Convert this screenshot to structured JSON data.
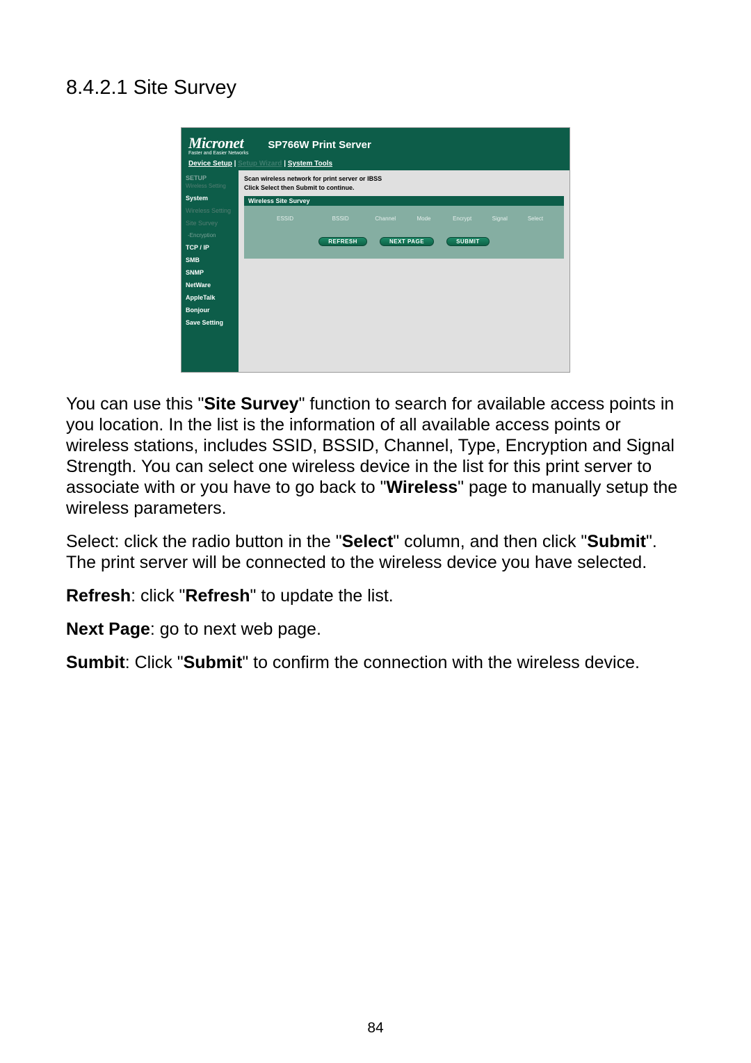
{
  "doc": {
    "heading": "8.4.2.1   Site Survey",
    "para1_pre": "You can use this \"",
    "para1_b1": "Site Survey",
    "para1_mid": "\" function to search for available access points in you location. In the list is the information of all available access points or wireless stations, includes SSID, BSSID, Channel, Type, Encryption and Signal Strength. You can select one wireless device in the list for this print server to associate with or you have to go back to \"",
    "para1_b2": "Wireless",
    "para1_end": "\" page to manually setup the wireless parameters.",
    "para2_pre": "Select: click the radio button in the \"",
    "para2_b1": "Select",
    "para2_mid": "\" column, and then click \"",
    "para2_b2": "Submit",
    "para2_end": "\". The print server will be connected to the wireless device you have selected.",
    "para3_b1": "Refresh",
    "para3_mid": ": click \"",
    "para3_b2": "Refresh",
    "para3_end": "\" to update the list.",
    "para4_b1": "Next Page",
    "para4_end": ": go to next web page.",
    "para5_b1": "Sumbit",
    "para5_mid": ": Click \"",
    "para5_b2": "Submit",
    "para5_end": "\" to confirm the connection with the wireless device.",
    "page_number": "84"
  },
  "screenshot": {
    "brand": "Micronet",
    "brand_sub": "Faster and Easier Networks",
    "title": "SP766W Print Server",
    "topnav": {
      "device_setup": "Device Setup",
      "setup_wizard": "Setup Wizard",
      "system_tools": "System Tools"
    },
    "sidebar": {
      "head": "SETUP",
      "sub": "Wireless Setting",
      "items": {
        "system": "System",
        "wireless_setting": "Wireless Setting",
        "site_survey": "Site Survey",
        "encryption": "-Encryption",
        "tcpip": "TCP / IP",
        "smb": "SMB",
        "snmp": "SNMP",
        "netware": "NetWare",
        "appletalk": "AppleTalk",
        "bonjour": "Bonjour",
        "save": "Save Setting"
      }
    },
    "main": {
      "instr_line1": "Scan wireless network for print server or IBSS",
      "instr_line2": "Click Select then Submit to continue.",
      "panel_head": "Wireless Site Survey",
      "cols": {
        "essid": "ESSID",
        "bssid": "BSSID",
        "channel": "Channel",
        "mode": "Mode",
        "encrypt": "Encrypt",
        "signal": "Signal",
        "select": "Select"
      },
      "buttons": {
        "refresh": "REFRESH",
        "next": "NEXT PAGE",
        "submit": "SUBMIT"
      }
    }
  }
}
